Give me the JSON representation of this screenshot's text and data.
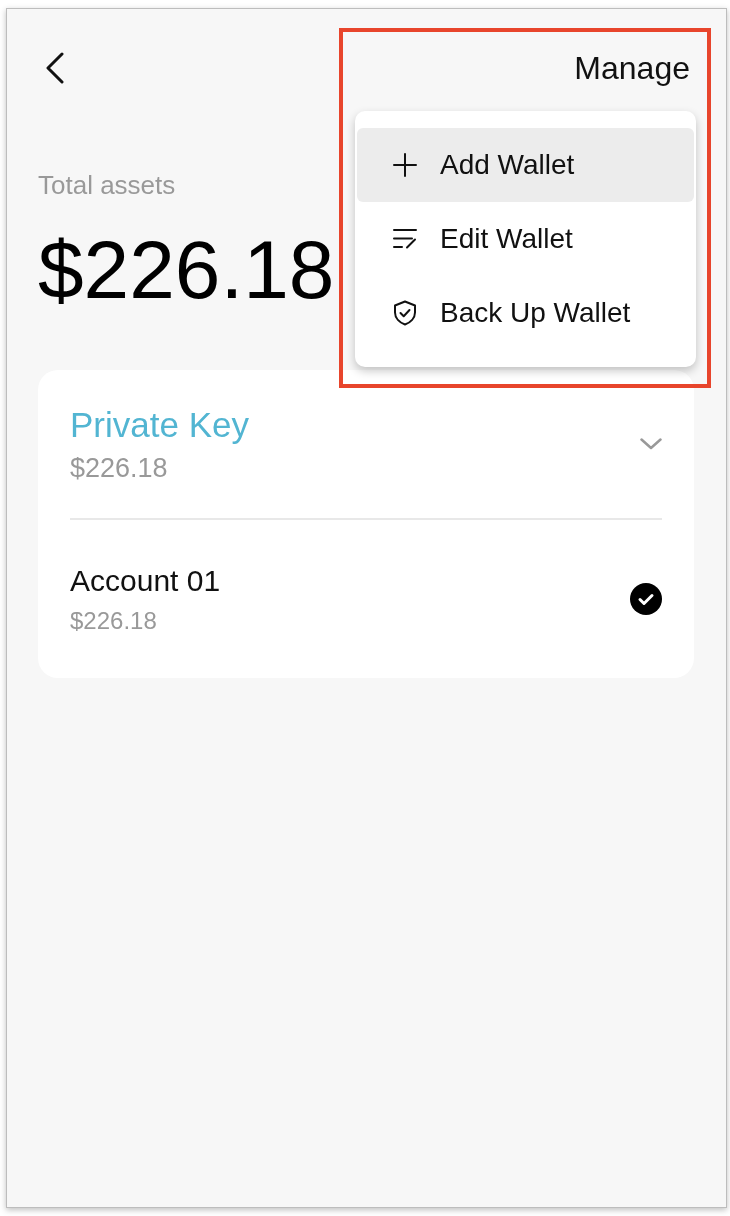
{
  "header": {
    "action": "Manage"
  },
  "menu": {
    "items": [
      {
        "kind": "add",
        "label": "Add Wallet",
        "selected": true
      },
      {
        "kind": "edit",
        "label": "Edit Wallet",
        "selected": false
      },
      {
        "kind": "backup",
        "label": "Back Up Wallet",
        "selected": false
      }
    ]
  },
  "total": {
    "label": "Total assets",
    "value": "$226.18"
  },
  "wallet": {
    "name": "Private Key",
    "balance": "$226.18",
    "accounts": [
      {
        "name": "Account 01",
        "balance": "$226.18",
        "selected": true
      }
    ]
  }
}
